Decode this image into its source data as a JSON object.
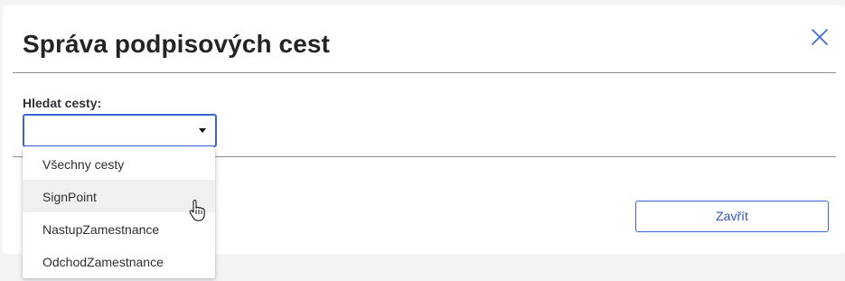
{
  "dialog": {
    "title": "Správa podpisových cest",
    "close_icon": "close-icon"
  },
  "search": {
    "label": "Hledat cesty:",
    "selected_value": "",
    "caret_icon": "caret-down-icon"
  },
  "dropdown": {
    "options": [
      {
        "label": "Všechny cesty"
      },
      {
        "label": "SignPoint"
      },
      {
        "label": "NastupZamestnance"
      },
      {
        "label": "OdchodZamestnance"
      }
    ],
    "hovered_index": 1
  },
  "footer": {
    "close_label": "Zavřít"
  },
  "colors": {
    "accent": "#3a64d8",
    "title": "#222426",
    "hover": "#f0f0f1",
    "background": "#f3f4f5"
  }
}
